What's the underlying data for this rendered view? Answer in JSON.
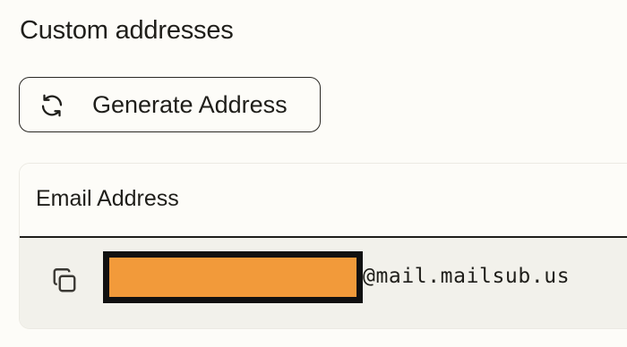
{
  "section": {
    "title": "Custom addresses"
  },
  "generate_button": {
    "label": "Generate Address",
    "icon": "refresh-icon"
  },
  "table": {
    "columns": [
      "Email Address"
    ],
    "rows": [
      {
        "copy_icon": "copy-icon",
        "local_part": "",
        "local_part_redacted": true,
        "domain": "@mail.mailsub.us"
      }
    ]
  },
  "colors": {
    "background": "#fdfcf8",
    "row_background": "#f2f1eb",
    "redaction_fill": "#f29a3a",
    "redaction_border": "#111111",
    "text": "#1f1e1a"
  }
}
